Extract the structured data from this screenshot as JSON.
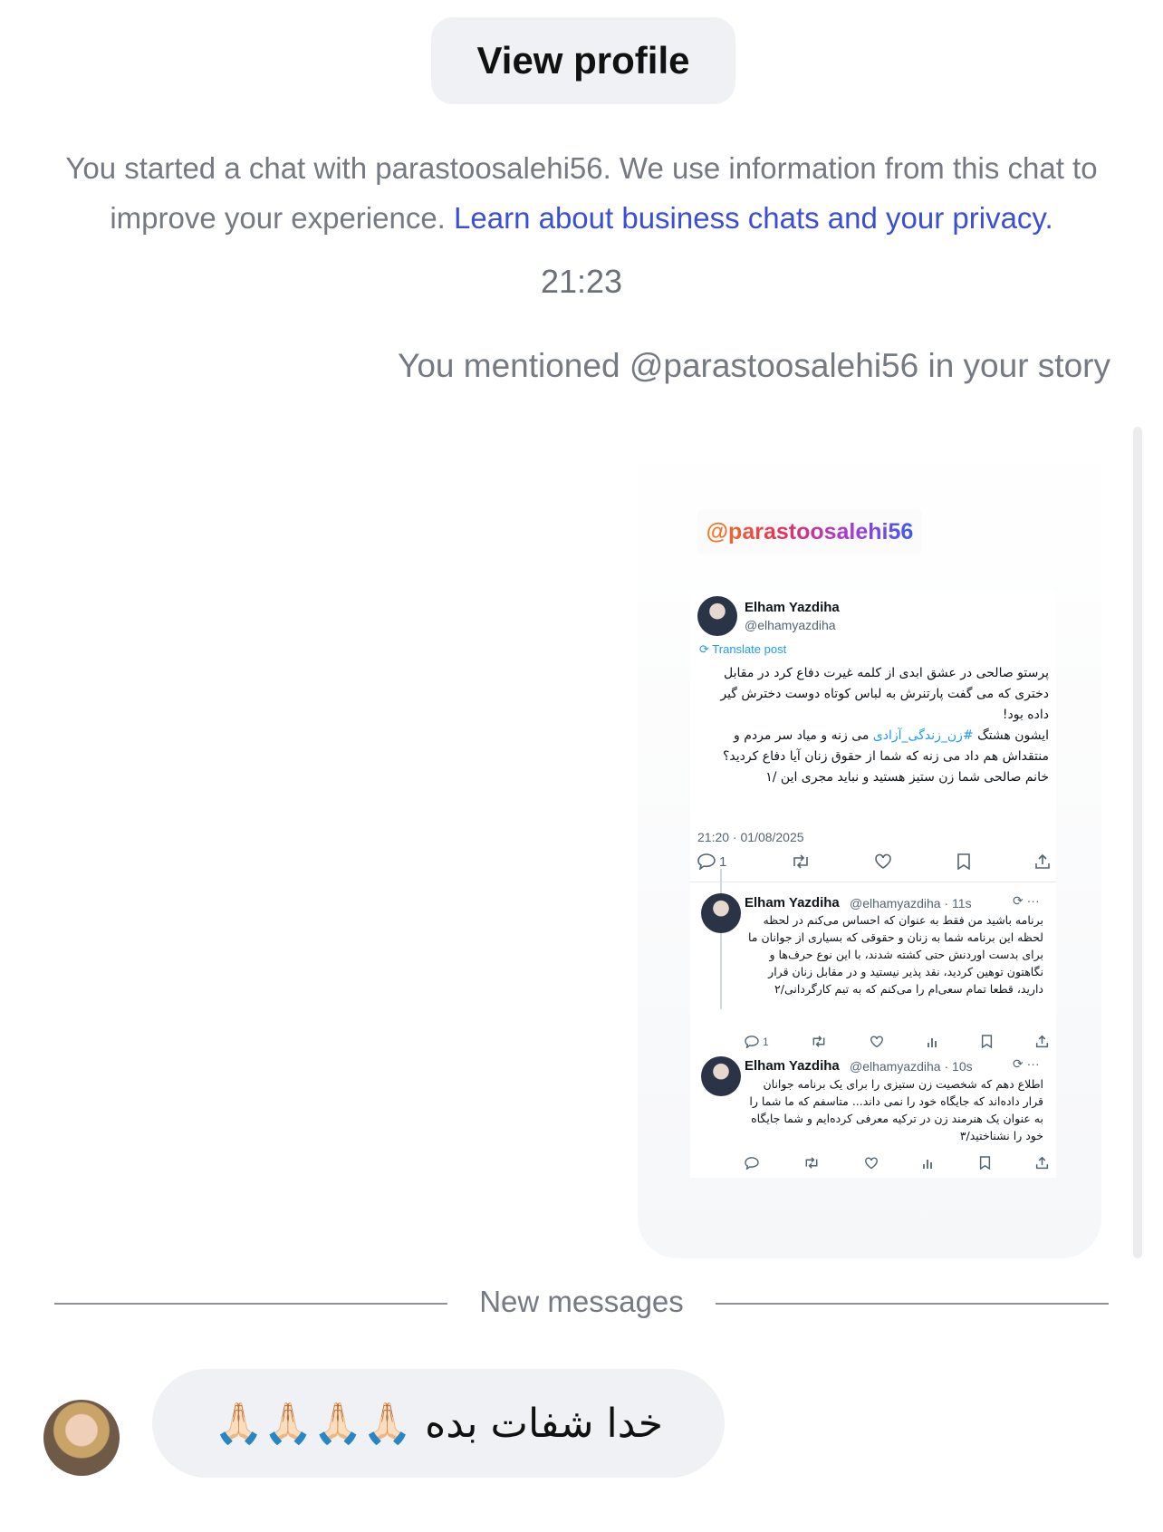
{
  "header": {
    "view_profile_label": "View profile"
  },
  "notice": {
    "text": "You started a chat with parastoosalehi56. We use information from this chat to improve your experience. ",
    "link": "Learn about business chats and your privacy."
  },
  "timestamp": "21:23",
  "story": {
    "mention_text": "You mentioned @parastoosalehi56 in your story",
    "handle_sticker": "@parastoosalehi56",
    "tweet": {
      "name": "Elham Yazdiha",
      "handle": "@elhamyazdiha",
      "translate_label": "Translate post",
      "text_part1": "پرستو صالحی در عشق ابدی از کلمه غیرت دفاع کرد در مقابل دختری که می گفت پارتنرش به لباس کوتاه دوست دخترش گیر داده بود!",
      "text_part2": "ایشون هشتگ ",
      "hashtag": "#زن_زندگی_آزادی",
      "text_part3": " می زنه و میاد سر مردم و منتقداش هم داد می زنه که شما از حقوق زنان آیا دفاع کردید؟",
      "text_part4": "خانم صالحی شما زن ستیز هستید و نباید مجری این /۱",
      "date": "21:20 · 01/08/2025",
      "reply_count": "1"
    },
    "replies": [
      {
        "name": "Elham Yazdiha",
        "meta": "@elhamyazdiha · 11s",
        "text": "برنامه باشید من فقط به عنوان که احساس می‌کنم در لحظه لحظه این برنامه شما به زنان و حقوقی که بسیاری از جوانان ما برای بدست اوردنش حتی کشته شدند، با این نوع حرف‌ها و نگاهتون توهین کردید، نقد پذیر نیستید و در مقابل زنان قرار دارید، قطعا تمام سعی‌ام را می‌کنم که به تیم کارگردانی/۲",
        "reply_count": "1"
      },
      {
        "name": "Elham Yazdiha",
        "meta": "@elhamyazdiha · 10s",
        "text": "اطلاع دهم که شخصیت زن ستیزی را برای یک برنامه جوانان قرار داده‌اند که جایگاه خود را نمی داند... متاسفم که ما شما را به عنوان یک هنرمند زن در ترکیه معرفی کرده‌ایم و شما جایگاه خود را نشناختید/۳",
        "reply_count": ""
      }
    ]
  },
  "new_messages_label": "New messages",
  "incoming_message": {
    "text": "خدا شفات بده 🙏🏻🙏🏻🙏🏻🙏🏻"
  }
}
